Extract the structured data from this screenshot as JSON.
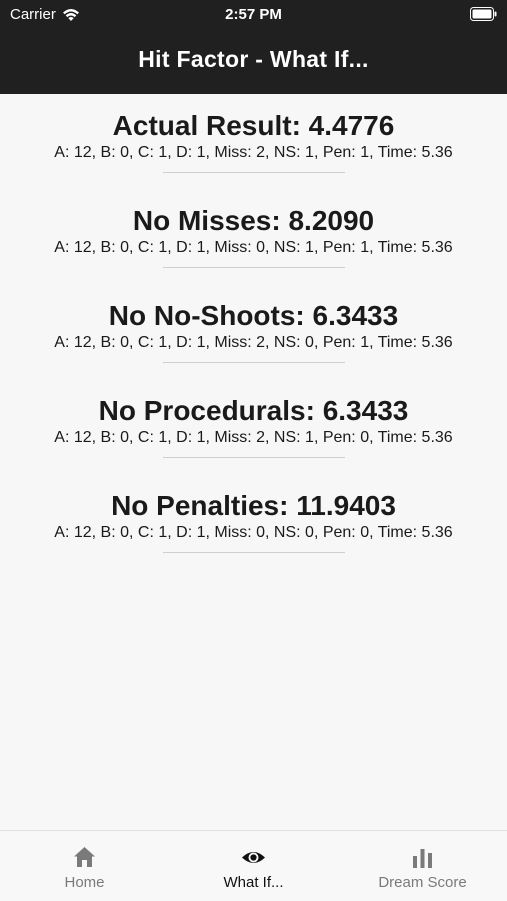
{
  "status_bar": {
    "carrier": "Carrier",
    "time": "2:57 PM",
    "wifi_icon": "wifi-icon",
    "battery_icon": "battery-icon"
  },
  "header": {
    "title": "Hit Factor - What If..."
  },
  "results": [
    {
      "title": "Actual Result: 4.4776",
      "detail": "A: 12, B: 0, C: 1, D: 1, Miss: 2, NS: 1, Pen: 1, Time: 5.36"
    },
    {
      "title": "No Misses: 8.2090",
      "detail": "A: 12, B: 0, C: 1, D: 1, Miss: 0, NS: 1, Pen: 1, Time: 5.36"
    },
    {
      "title": "No No-Shoots: 6.3433",
      "detail": "A: 12, B: 0, C: 1, D: 1, Miss: 2, NS: 0, Pen: 1, Time: 5.36"
    },
    {
      "title": "No Procedurals: 6.3433",
      "detail": "A: 12, B: 0, C: 1, D: 1, Miss: 2, NS: 1, Pen: 0, Time: 5.36"
    },
    {
      "title": "No Penalties: 11.9403",
      "detail": "A: 12, B: 0, C: 1, D: 1, Miss: 0, NS: 0, Pen: 0, Time: 5.36"
    }
  ],
  "tab_bar": {
    "tabs": [
      {
        "label": "Home",
        "icon": "home-icon",
        "active": false
      },
      {
        "label": "What If...",
        "icon": "eye-icon",
        "active": true
      },
      {
        "label": "Dream Score",
        "icon": "bar-chart-icon",
        "active": false
      }
    ]
  },
  "colors": {
    "header_background": "#202020",
    "page_background": "#f7f7f7",
    "active_tab": "#111111",
    "inactive_tab": "#7a7a7a",
    "divider": "#cfcfcf"
  }
}
